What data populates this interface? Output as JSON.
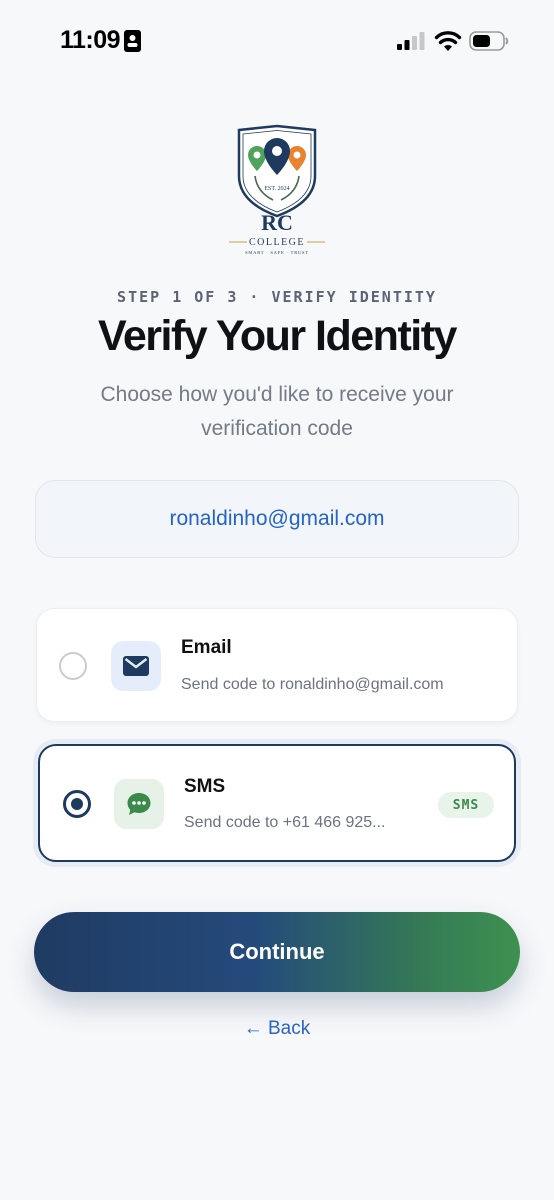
{
  "status_bar": {
    "time": "11:09",
    "icons": [
      "id-card-icon",
      "cellular-signal-icon",
      "wifi-icon",
      "battery-icon"
    ]
  },
  "logo": {
    "name": "RC",
    "subname": "COLLEGE",
    "tagline": "SMART · SAFE · TRUST",
    "est": "EST. 2024",
    "colors": {
      "navy": "#1e3a5f",
      "green": "#4fa35a",
      "orange": "#e8832f",
      "gold": "#c9a14a"
    }
  },
  "header": {
    "step": "STEP 1 OF 3 · VERIFY IDENTITY",
    "title": "Verify Your Identity",
    "subtitle": "Choose how you'd like to receive your verification code"
  },
  "account": {
    "email": "ronaldinho@gmail.com"
  },
  "options": [
    {
      "title": "Email",
      "subtitle": "Send code to ronaldinho@gmail.com",
      "icon": "envelope-icon",
      "selected": false
    },
    {
      "title": "SMS",
      "subtitle": "Send code to +61 466 925...",
      "icon": "chat-bubble-icon",
      "selected": true,
      "badge": "SMS"
    }
  ],
  "actions": {
    "continue_label": "Continue",
    "back_label": "← Back"
  },
  "colors": {
    "primary_navy": "#1e3a5f",
    "accent_green": "#3e9150",
    "link_blue": "#2563c9",
    "background": "#f7f8fa"
  }
}
